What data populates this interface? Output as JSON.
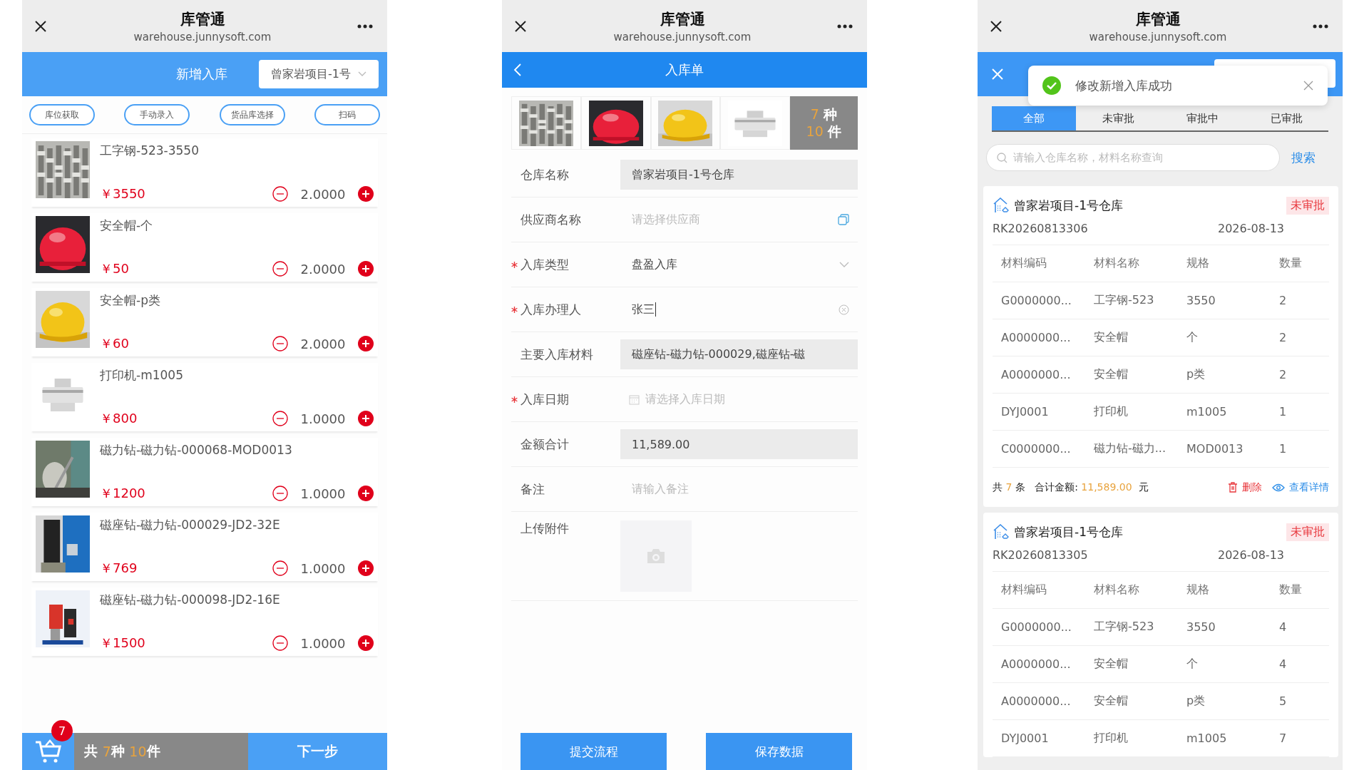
{
  "screens": [
    {
      "kind": "cart",
      "top_bar": {
        "title": "库管通",
        "url": "warehouse.junnysoft.com"
      },
      "header": {
        "title": "新增入库",
        "warehouse_select": "曾家岩项目-1号"
      },
      "actions": [
        "库位获取",
        "手动录入",
        "货品库选择",
        "扫码"
      ],
      "items": [
        {
          "name": "工字钢-523-3550",
          "price": "￥3550",
          "quantity": "2.0000"
        },
        {
          "name": "安全帽-个",
          "price": "￥50",
          "quantity": "2.0000"
        },
        {
          "name": "安全帽-p类",
          "price": "￥60",
          "quantity": "2.0000"
        },
        {
          "name": "打印机-m1005",
          "price": "￥800",
          "quantity": "1.0000"
        },
        {
          "name": "磁力钻-磁力钻-000068-MOD0013",
          "price": "￥1200",
          "quantity": "1.0000"
        },
        {
          "name": "磁座钻-磁力钻-000029-JD2-32E",
          "price": "￥769",
          "quantity": "1.0000"
        },
        {
          "name": "磁座钻-磁力钻-000098-JD2-16E",
          "price": "￥1500",
          "quantity": "1.0000"
        }
      ],
      "footer": {
        "cart_badge": "7",
        "summary": {
          "prefix": "共",
          "kinds": "7",
          "kinds_unit": "种",
          "count": "10",
          "count_unit": "件"
        },
        "next_button": "下一步"
      }
    },
    {
      "kind": "form",
      "top_bar": {
        "title": "库管通",
        "url": "warehouse.junnysoft.com"
      },
      "header": {
        "title": "入库单"
      },
      "thumbnails": [
        {
          "kind": "picture"
        },
        {
          "kind": "picture"
        },
        {
          "kind": "picture"
        },
        {
          "kind": "picture"
        }
      ],
      "thumbnail_summary": {
        "kinds": "7",
        "kinds_unit": "种",
        "count": "10",
        "count_unit": "件"
      },
      "fields": [
        {
          "label": "仓库名称",
          "kind": "readonly",
          "value": "曾家岩项目-1号仓库",
          "required": false
        },
        {
          "label": "供应商名称",
          "kind": "picker",
          "placeholder": "请选择供应商",
          "required": false
        },
        {
          "label": "入库类型",
          "kind": "select",
          "value": "盘盈入库",
          "required": true
        },
        {
          "label": "入库办理人",
          "kind": "input",
          "value": "张三",
          "focused": true,
          "required": true
        },
        {
          "label": "主要入库材料",
          "kind": "readonly",
          "value": "磁座钻-磁力钻-000029,磁座钻-磁",
          "required": false
        },
        {
          "label": "入库日期",
          "kind": "date",
          "placeholder": "请选择入库日期",
          "required": true
        },
        {
          "label": "金额合计",
          "kind": "readonly",
          "value": "11,589.00",
          "required": false
        },
        {
          "label": "备注",
          "kind": "textarea",
          "placeholder": "请输入备注",
          "required": false
        },
        {
          "label": "上传附件",
          "kind": "upload",
          "required": false
        }
      ],
      "buttons": [
        "提交流程",
        "保存数据"
      ]
    },
    {
      "kind": "list",
      "top_bar": {
        "title": "库管通",
        "url": "warehouse.junnysoft.com"
      },
      "toast": {
        "message": "修改新增入库成功"
      },
      "tabs": [
        {
          "label": "全部",
          "selected": true
        },
        {
          "label": "未审批",
          "selected": false
        },
        {
          "label": "审批中",
          "selected": false
        },
        {
          "label": "已审批",
          "selected": false
        }
      ],
      "search": {
        "placeholder": "请输入仓库名称，材料名称查询",
        "button": "搜索"
      },
      "records": [
        {
          "warehouse": "曾家岩项目-1号仓库",
          "status": "未审批",
          "code": "RK20260813306",
          "date": "2026-08-13",
          "columns": [
            "材料编码",
            "材料名称",
            "规格",
            "数量"
          ],
          "rows": [
            [
              "G0000000...",
              "工字钢-523",
              "3550",
              "2"
            ],
            [
              "A0000000...",
              "安全帽",
              "个",
              "2"
            ],
            [
              "A0000000...",
              "安全帽",
              "p类",
              "2"
            ],
            [
              "DYJ0001",
              "打印机",
              "m1005",
              "1"
            ],
            [
              "C0000000...",
              "磁力钻-磁力...",
              "MOD0013",
              "1"
            ]
          ],
          "footer": {
            "prefix": "共",
            "count": "7",
            "count_unit": "条",
            "total_label": "合计金额:",
            "total": "11,589.00",
            "currency": "元",
            "delete": "删除",
            "detail": "查看详情"
          }
        },
        {
          "warehouse": "曾家岩项目-1号仓库",
          "status": "未审批",
          "code": "RK20260813305",
          "date": "2026-08-13",
          "columns": [
            "材料编码",
            "材料名称",
            "规格",
            "数量"
          ],
          "rows": [
            [
              "G0000000...",
              "工字钢-523",
              "3550",
              "4"
            ],
            [
              "A0000000...",
              "安全帽",
              "个",
              "4"
            ],
            [
              "A0000000...",
              "安全帽",
              "p类",
              "5"
            ],
            [
              "DYJ0001",
              "打印机",
              "m1005",
              "7"
            ]
          ]
        }
      ]
    }
  ]
}
